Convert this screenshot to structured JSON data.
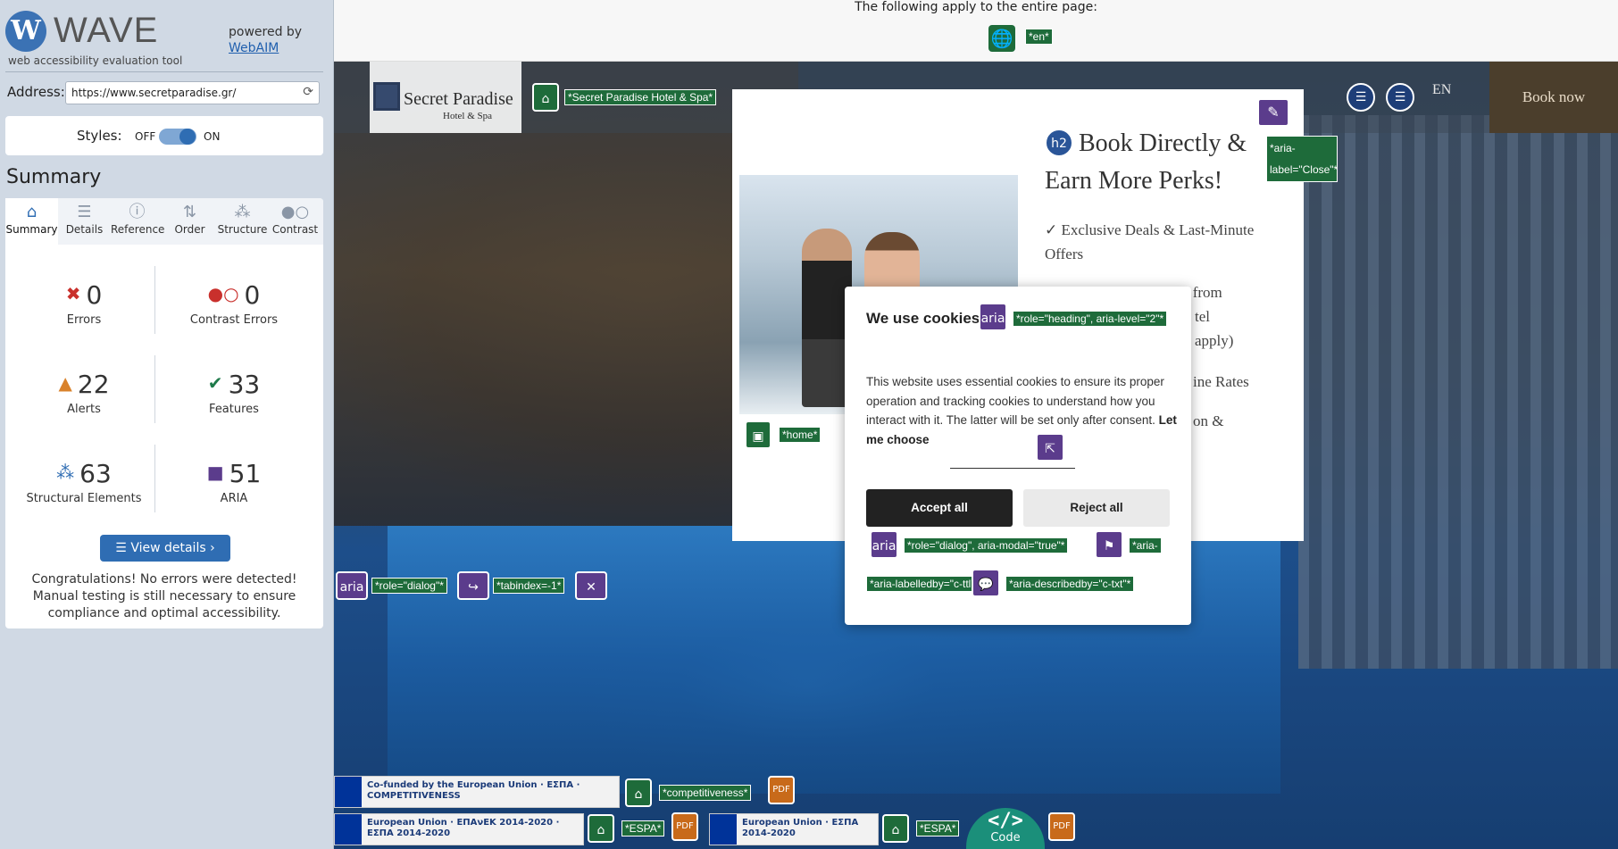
{
  "wave": {
    "logo_letter": "W",
    "name": "WAVE",
    "subtitle": "web accessibility evaluation tool",
    "powered_by": "powered by",
    "powered_link": "WebAIM",
    "address_label": "Address:",
    "address_value": "https://www.secretparadise.gr/",
    "styles_label": "Styles:",
    "styles_off": "OFF",
    "styles_on": "ON",
    "summary_title": "Summary",
    "tabs": [
      {
        "label": "Summary",
        "icon": "home-icon"
      },
      {
        "label": "Details",
        "icon": "list-icon"
      },
      {
        "label": "Reference",
        "icon": "info-icon"
      },
      {
        "label": "Order",
        "icon": "order-icon"
      },
      {
        "label": "Structure",
        "icon": "structure-icon"
      },
      {
        "label": "Contrast",
        "icon": "contrast-icon"
      }
    ],
    "stats": {
      "errors": {
        "count": "0",
        "label": "Errors"
      },
      "contrast_errors": {
        "count": "0",
        "label": "Contrast Errors"
      },
      "alerts": {
        "count": "22",
        "label": "Alerts"
      },
      "features": {
        "count": "33",
        "label": "Features"
      },
      "structural": {
        "count": "63",
        "label": "Structural Elements"
      },
      "aria": {
        "count": "51",
        "label": "ARIA"
      }
    },
    "view_details": "View details ›",
    "congrats": "Congratulations! No errors were detected! Manual testing is still necessary to ensure compliance and optimal accessibility."
  },
  "page": {
    "apply_text": "The following apply to the entire page:",
    "lang_tag": "*en*",
    "logo_name": "Secret Paradise",
    "logo_sub": "Hotel & Spa",
    "logo_tag": "*Secret Paradise Hotel & Spa*",
    "lang_switch": "EN",
    "book_now": "Book now",
    "promo": {
      "heading_badge": "h2",
      "heading": "Book Directly & Earn More Perks!",
      "items": [
        "✓ Exclusive Deals & Last-Minute Offers",
        "sfer from",
        "tel",
        "apply)",
        "ine Rates",
        "on &"
      ],
      "close_tag": "*aria-label=\"Close\"*",
      "home_tag": "*home*"
    },
    "cookie": {
      "title": "We use cookies!",
      "heading_tag": "*role=\"heading\", aria-level=\"2\"*",
      "text": "This website uses essential cookies to ensure its proper operation and tracking cookies to understand how you interact with it. The latter will be set only after consent.",
      "choose": "Let me choose",
      "accept": "Accept all",
      "reject": "Reject all",
      "dialog_tag": "*role=\"dialog\", aria-modal=\"true\"*",
      "labelledby_tag": "*aria-labelledby=\"c-ttl\"*",
      "describedby_tag": "*aria-describedby=\"c-txt\"*"
    },
    "side_tags": {
      "role_dialog": "*role=\"dialog\"*",
      "tabindex": "*tabindex=-1*"
    },
    "footer": {
      "competitiveness_tag": "*competitiveness*",
      "espa_tag1": "*ESPA*",
      "espa_tag2": "*ESPA*",
      "logo1": "Co-funded by the European Union",
      "logo1b": "ΕΣΠΑ",
      "logo1c": "COMPETITIVENESS",
      "logo2": "European Union",
      "logo2b": "ΕΠΑνΕΚ 2014-2020",
      "logo2c": "ΕΣΠΑ 2014-2020",
      "logo3": "European Union",
      "logo3b": "ΕΣΠΑ 2014-2020",
      "code": "Code"
    },
    "aria_word": "aria"
  },
  "colors": {
    "wave_blue": "#2f6db3",
    "feature_green": "#1e6b3a",
    "aria_purple": "#5b3c8c",
    "error_red": "#c9302c",
    "alert_orange": "#d9822b"
  }
}
